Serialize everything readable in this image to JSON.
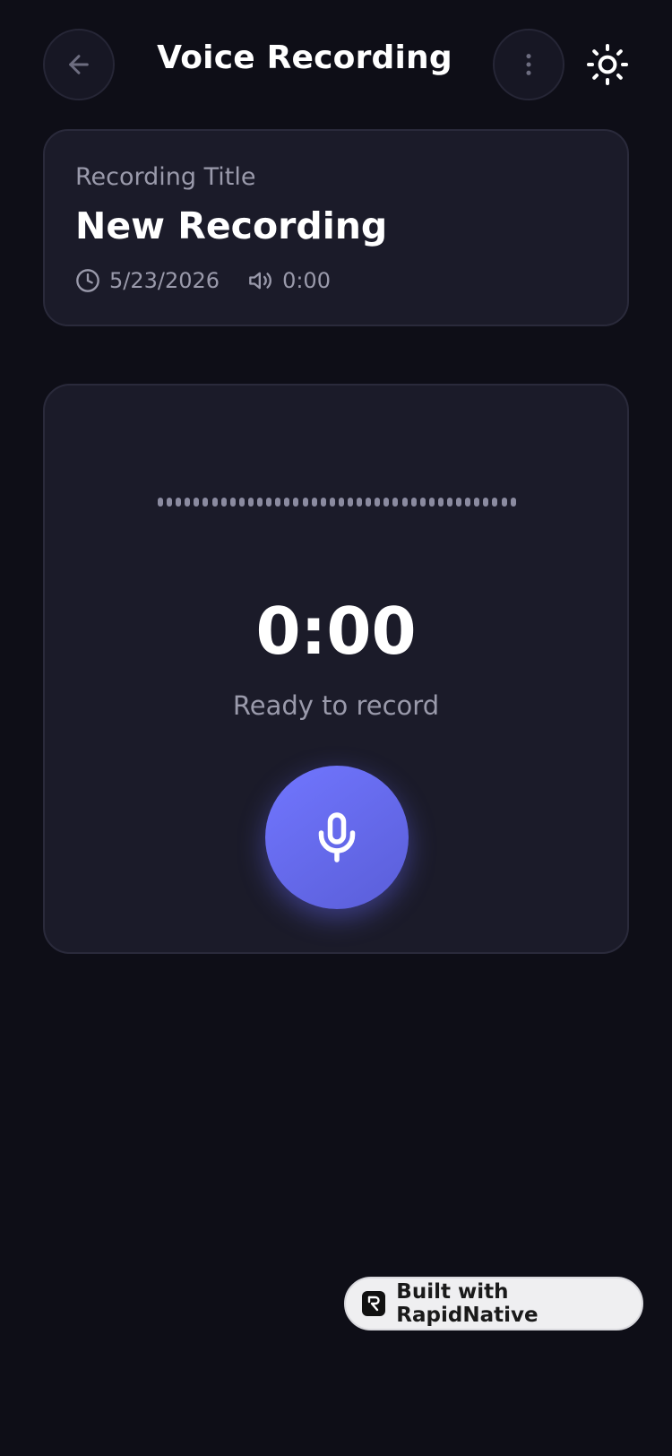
{
  "header": {
    "title": "Voice Recording"
  },
  "recording": {
    "label": "Recording Title",
    "title": "New Recording",
    "date": "5/23/2026",
    "duration": "0:00"
  },
  "recorder": {
    "timer": "0:00",
    "status": "Ready to record",
    "waveform_bars": 40
  },
  "badge": {
    "text": "Built with RapidNative"
  },
  "colors": {
    "background": "#0e0e17",
    "card": "#1b1b29",
    "accent": "#6366f1",
    "muted_text": "#9a9aab"
  },
  "icons": {
    "back": "arrow-left-icon",
    "menu": "more-vertical-icon",
    "theme": "sun-icon",
    "date": "clock-icon",
    "duration": "volume-icon",
    "record": "microphone-icon",
    "badge": "rapidnative-logo-icon"
  }
}
